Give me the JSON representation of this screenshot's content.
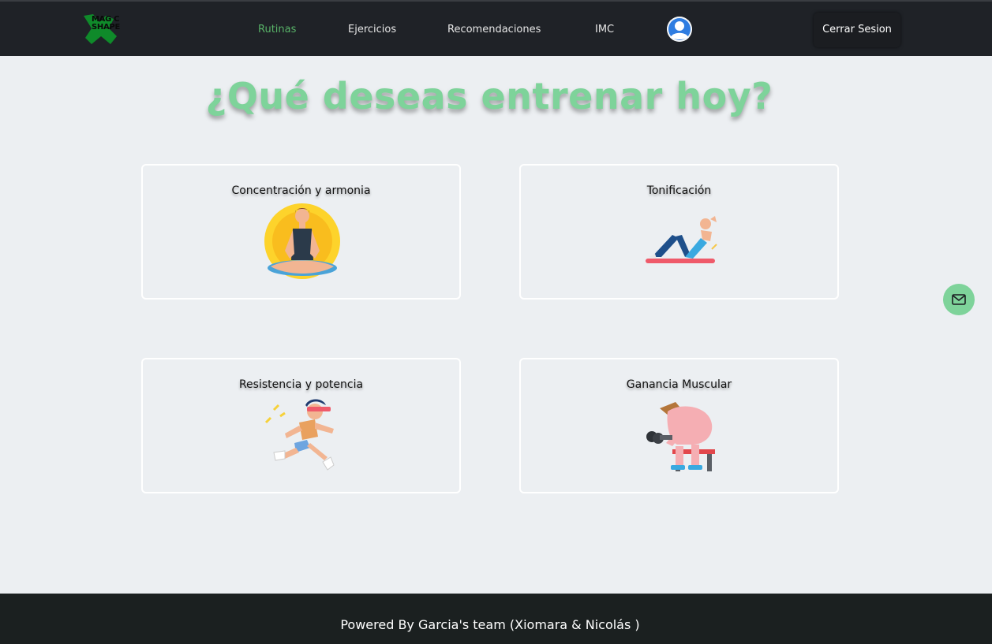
{
  "brand": {
    "logo_line1": "MAG C",
    "logo_line2": "SHAPE"
  },
  "nav": {
    "items": [
      {
        "label": "Rutinas",
        "active": true
      },
      {
        "label": "Ejercicios",
        "active": false
      },
      {
        "label": "Recomendaciones",
        "active": false
      },
      {
        "label": "IMC",
        "active": false
      }
    ],
    "logout_label": "Cerrar Sesion"
  },
  "main": {
    "title": "¿Qué deseas entrenar hoy?",
    "cards": [
      {
        "label": "Concentración y armonia",
        "icon": "meditation-icon"
      },
      {
        "label": "Tonificación",
        "icon": "situp-icon"
      },
      {
        "label": "Resistencia y potencia",
        "icon": "runner-icon"
      },
      {
        "label": "Ganancia Muscular",
        "icon": "bodybuilder-icon"
      }
    ]
  },
  "footer": {
    "text": "Powered By Garcia's team (Xiomara & Nicolás )"
  },
  "colors": {
    "accent_green": "#7ed39a",
    "active_link": "#58b368",
    "navbar_bg": "#1f2227",
    "footer_bg": "#1b2020",
    "page_bg": "#eceff2"
  }
}
